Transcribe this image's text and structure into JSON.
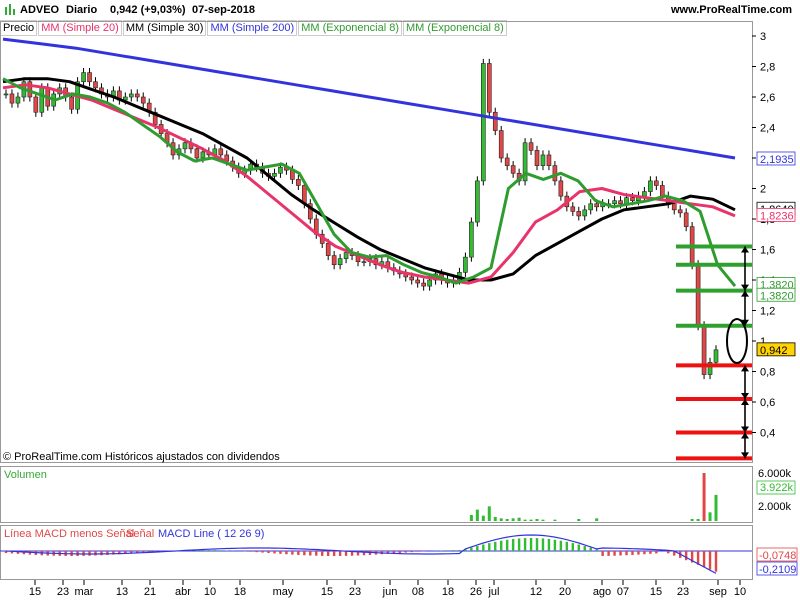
{
  "header": {
    "ticker": "ADVEO",
    "period": "Diario",
    "price_change": "0,942 (+9,03%)",
    "date": "07-sep-2018",
    "site": "www.ProRealTime.com"
  },
  "legend": [
    {
      "label": "Precio",
      "color": "#000000"
    },
    {
      "label": "MM (Simple 20)",
      "color": "#e8336b"
    },
    {
      "label": "MM (Simple 30)",
      "color": "#000000"
    },
    {
      "label": "MM (Simple 200)",
      "color": "#3333dd"
    },
    {
      "label": "MM (Exponencial 8)",
      "color": "#2e9c2e"
    },
    {
      "label": "MM (Exponencial 8)",
      "color": "#2e9c2e"
    }
  ],
  "copyright": "© ProRealTime.com  Históricos ajustados con dividendos",
  "volume_panel": {
    "title": "Volumen",
    "ticks": [
      "6.000k",
      "2.000k"
    ],
    "last_label": "3.922k",
    "last_color": "#33bb33"
  },
  "macd_panel": {
    "title_parts": [
      "Línea MACD menos Señal",
      "Señal",
      "MACD Line ( 12 26 9)"
    ],
    "labels": [
      "-0,0748",
      "-0,2109"
    ]
  },
  "price_labels": [
    {
      "text": "2,1935",
      "value": 2.1935,
      "color": "#3333dd"
    },
    {
      "text": "1,8640",
      "value": 1.864,
      "color": "#000000"
    },
    {
      "text": "1,8236",
      "value": 1.8236,
      "color": "#e8336b"
    },
    {
      "text": "1,3820",
      "value": 1.37,
      "color": "#2e9c2e"
    },
    {
      "text": "1,3820",
      "value": 1.3,
      "color": "#2e9c2e"
    },
    {
      "text": "0,942",
      "value": 0.942,
      "color": "#000000",
      "fill": "#ffd200"
    }
  ],
  "chart_data": {
    "type": "line",
    "ylim": [
      0.2,
      3.0
    ],
    "y_ticks": [
      "3",
      "2,8",
      "2,6",
      "2,4",
      "2,2",
      "2",
      "1,8",
      "1,6",
      "1,4",
      "1,2",
      "1",
      "0,8",
      "0,6",
      "0,4"
    ],
    "x_ticks": [
      "15",
      "23",
      "mar",
      "13",
      "21",
      "abr",
      "10",
      "18",
      "may",
      "15",
      "23",
      "jun",
      "08",
      "18",
      "26",
      "jul",
      "12",
      "20",
      "ago",
      "07",
      "15",
      "23",
      "sep",
      "10"
    ],
    "close": [
      2.62,
      2.56,
      2.6,
      2.7,
      2.6,
      2.5,
      2.66,
      2.54,
      2.62,
      2.66,
      2.6,
      2.52,
      2.7,
      2.76,
      2.7,
      2.66,
      2.62,
      2.6,
      2.64,
      2.58,
      2.6,
      2.62,
      2.6,
      2.56,
      2.5,
      2.42,
      2.36,
      2.3,
      2.22,
      2.26,
      2.3,
      2.26,
      2.2,
      2.24,
      2.22,
      2.26,
      2.22,
      2.18,
      2.14,
      2.1,
      2.12,
      2.16,
      2.14,
      2.1,
      2.08,
      2.1,
      2.14,
      2.12,
      2.06,
      2.02,
      1.9,
      1.8,
      1.7,
      1.64,
      1.56,
      1.5,
      1.54,
      1.58,
      1.56,
      1.52,
      1.52,
      1.54,
      1.5,
      1.52,
      1.48,
      1.46,
      1.44,
      1.42,
      1.4,
      1.38,
      1.36,
      1.4,
      1.44,
      1.4,
      1.38,
      1.4,
      1.45,
      1.55,
      1.78,
      2.05,
      2.82,
      2.5,
      2.38,
      2.2,
      2.15,
      2.1,
      2.05,
      2.3,
      2.25,
      2.15,
      2.22,
      2.15,
      2.05,
      1.95,
      1.88,
      1.85,
      1.82,
      1.86,
      1.9,
      1.88,
      1.9,
      1.9,
      1.92,
      1.9,
      1.94,
      1.92,
      1.95,
      1.98,
      2.05,
      2.02,
      1.95,
      1.9,
      1.86,
      1.84,
      1.75,
      1.5,
      1.1,
      0.78,
      0.86,
      0.942
    ],
    "series": [
      {
        "name": "MM (Simple 200)",
        "color": "#3333dd",
        "values": [
          2.98,
          2.95,
          2.92,
          2.88,
          2.84,
          2.8,
          2.76,
          2.72,
          2.68,
          2.64,
          2.6,
          2.56,
          2.52,
          2.48,
          2.44,
          2.4,
          2.36,
          2.32,
          2.28,
          2.24,
          2.2
        ]
      },
      {
        "name": "MM (Simple 30)",
        "color": "#000000",
        "values": [
          2.7,
          2.72,
          2.72,
          2.7,
          2.65,
          2.6,
          2.54,
          2.48,
          2.42,
          2.36,
          2.28,
          2.2,
          2.08,
          1.96,
          1.86,
          1.77,
          1.68,
          1.6,
          1.54,
          1.48,
          1.44,
          1.4,
          1.4,
          1.44,
          1.56,
          1.64,
          1.72,
          1.8,
          1.86,
          1.88,
          1.9,
          1.95,
          1.93,
          1.86
        ]
      },
      {
        "name": "MM (Simple 20)",
        "color": "#e8336b",
        "values": [
          2.66,
          2.68,
          2.66,
          2.62,
          2.58,
          2.52,
          2.46,
          2.4,
          2.33,
          2.26,
          2.18,
          2.08,
          1.96,
          1.84,
          1.72,
          1.62,
          1.56,
          1.5,
          1.45,
          1.42,
          1.4,
          1.38,
          1.42,
          1.58,
          1.78,
          1.86,
          1.98,
          2.0,
          1.96,
          1.94,
          1.92,
          1.9,
          1.88,
          1.82
        ]
      },
      {
        "name": "MM (Exponencial 8)",
        "color": "#2e9c2e",
        "values": [
          2.72,
          2.66,
          2.62,
          2.58,
          2.62,
          2.6,
          2.56,
          2.5,
          2.42,
          2.34,
          2.24,
          2.18,
          2.2,
          2.16,
          2.12,
          2.14,
          2.16,
          2.1,
          1.9,
          1.7,
          1.58,
          1.55,
          1.56,
          1.5,
          1.45,
          1.42,
          1.38,
          1.42,
          1.48,
          2.0,
          2.1,
          2.06,
          2.1,
          2.05,
          1.92,
          1.88,
          1.9,
          1.92,
          1.95,
          1.92,
          1.85,
          1.5,
          1.36
        ]
      }
    ],
    "volume": [
      0,
      0,
      0,
      0,
      0,
      0,
      0,
      0,
      0,
      0,
      0,
      0,
      0,
      0,
      0,
      0,
      0,
      0,
      0,
      0,
      0,
      0,
      0,
      0,
      0,
      0,
      0,
      0,
      0,
      0,
      0,
      0,
      0,
      0,
      0,
      0,
      0,
      0,
      0,
      0,
      0,
      0,
      0,
      0,
      0,
      0,
      0,
      0,
      0,
      0,
      0,
      0,
      0,
      0,
      0,
      0,
      0,
      0,
      0,
      0,
      0,
      0,
      0,
      0,
      0,
      0,
      0,
      0,
      0,
      0,
      0,
      0,
      0,
      0,
      0,
      0,
      0,
      0,
      900,
      1700,
      800,
      2200,
      600,
      400,
      300,
      400,
      500,
      200,
      200,
      300,
      200,
      0,
      200,
      0,
      0,
      0,
      300,
      0,
      0,
      400,
      0,
      0,
      0,
      0,
      0,
      0,
      0,
      0,
      0,
      0,
      0,
      0,
      0,
      0,
      0,
      300,
      300,
      7200,
      1300,
      3922
    ],
    "annotation_lines": [
      {
        "value": 1.62,
        "color": "#2ea02e"
      },
      {
        "value": 1.5,
        "color": "#2ea02e"
      },
      {
        "value": 1.33,
        "color": "#2ea02e"
      },
      {
        "value": 1.1,
        "color": "#2ea02e"
      },
      {
        "value": 0.84,
        "color": "#ee1111"
      },
      {
        "value": 0.62,
        "color": "#ee1111"
      },
      {
        "value": 0.4,
        "color": "#ee1111"
      },
      {
        "value": 0.23,
        "color": "#ee1111"
      }
    ]
  }
}
